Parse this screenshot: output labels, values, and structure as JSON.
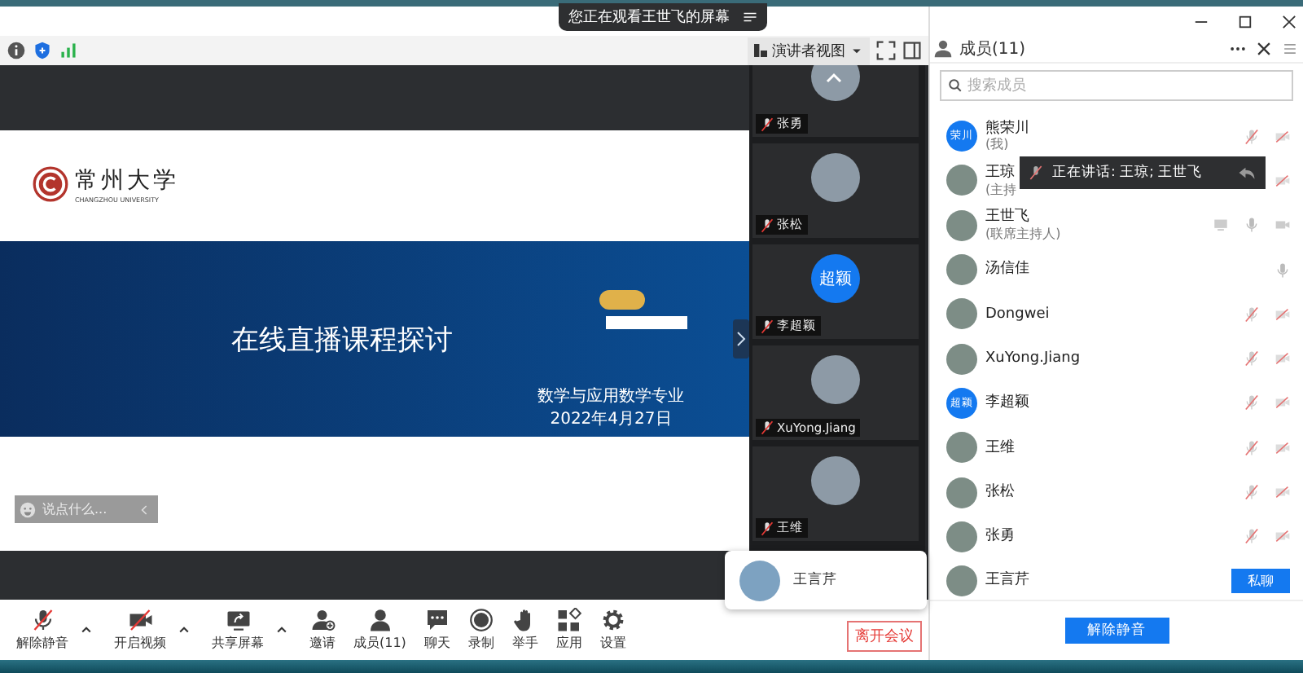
{
  "screen_banner": {
    "text": "您正在观看王世飞的屏幕"
  },
  "view_menu": {
    "label": "演讲者视图"
  },
  "slide": {
    "logo_name": "常州大学",
    "logo_subtitle": "CHANGZHOU UNIVERSITY",
    "title": "在线直播课程探讨",
    "subtitle": "数学与应用数学专业",
    "date": "2022年4月27日"
  },
  "chat_input": {
    "placeholder": "说点什么..."
  },
  "video_tiles": [
    {
      "name": "张勇",
      "avatar": {
        "kind": "photo"
      }
    },
    {
      "name": "张松",
      "avatar": {
        "kind": "photo"
      }
    },
    {
      "name": "李超颖",
      "avatar": {
        "kind": "initials",
        "text": "超颖"
      }
    },
    {
      "name": "XuYong.Jiang",
      "avatar": {
        "kind": "photo"
      }
    },
    {
      "name": "王维",
      "avatar": {
        "kind": "photo"
      }
    }
  ],
  "toolbar": [
    {
      "label": "解除静音",
      "kind": "mic-muted",
      "menu": true
    },
    {
      "label": "开启视频",
      "kind": "video-off",
      "menu": true
    },
    {
      "label": "共享屏幕",
      "kind": "share",
      "menu": true
    },
    {
      "label": "邀请",
      "kind": "invite",
      "menu": false
    },
    {
      "label": "成员(11)",
      "kind": "members",
      "menu": false
    },
    {
      "label": "聊天",
      "kind": "chat",
      "menu": false
    },
    {
      "label": "录制",
      "kind": "record",
      "menu": false
    },
    {
      "label": "举手",
      "kind": "hand",
      "menu": false
    },
    {
      "label": "应用",
      "kind": "apps",
      "menu": false
    },
    {
      "label": "设置",
      "kind": "settings",
      "menu": false
    }
  ],
  "leave_button": {
    "label": "离开会议"
  },
  "hover_card": {
    "name": "王言芹"
  },
  "members_panel": {
    "title": "成员(11)",
    "search_placeholder": "搜索成员",
    "footer_button": "解除静音",
    "members": [
      {
        "name": "熊荣川",
        "role": "(我)",
        "avatar": {
          "kind": "initials",
          "text": "荣川"
        },
        "sharing": false,
        "mic_muted": true,
        "video_off": true
      },
      {
        "name": "王琼",
        "role": "(主持",
        "avatar": {
          "kind": "photo"
        },
        "sharing": false,
        "video_off": true
      },
      {
        "name": "王世飞",
        "role": "(联席主持人)",
        "avatar": {
          "kind": "photo"
        },
        "sharing": true,
        "mic_muted": false,
        "video_off": false
      },
      {
        "name": "汤信佳",
        "avatar": {
          "kind": "photo"
        },
        "sharing": false,
        "mic_muted": false
      },
      {
        "name": "Dongwei",
        "avatar": {
          "kind": "photo"
        },
        "sharing": false,
        "mic_muted": true,
        "video_off": true
      },
      {
        "name": "XuYong.Jiang",
        "avatar": {
          "kind": "photo"
        },
        "sharing": false,
        "mic_muted": true,
        "video_off": true
      },
      {
        "name": "李超颖",
        "avatar": {
          "kind": "initials",
          "text": "超颖"
        },
        "sharing": false,
        "mic_muted": true,
        "video_off": true
      },
      {
        "name": "王维",
        "avatar": {
          "kind": "photo"
        },
        "sharing": false,
        "mic_muted": true,
        "video_off": true
      },
      {
        "name": "张松",
        "avatar": {
          "kind": "photo"
        },
        "sharing": false,
        "mic_muted": true,
        "video_off": true
      },
      {
        "name": "张勇",
        "avatar": {
          "kind": "photo"
        },
        "sharing": false,
        "mic_muted": true,
        "video_off": true
      },
      {
        "name": "王言芹",
        "avatar": {
          "kind": "photo"
        },
        "sharing": false,
        "action": "私聊"
      }
    ]
  },
  "speaking_toast": {
    "text": "正在讲话: 王琼; 王世飞"
  }
}
